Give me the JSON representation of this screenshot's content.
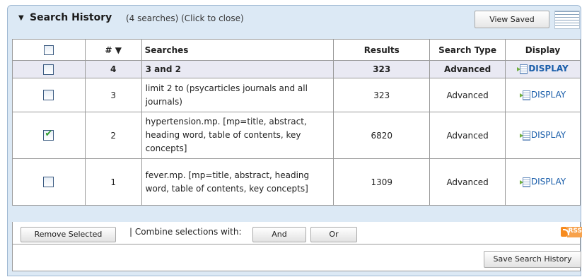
{
  "header": {
    "toggle_icon": "triangle-down-icon",
    "title": "Search History",
    "subtitle": "(4 searches) (Click to close)",
    "view_saved_label": "View Saved"
  },
  "table": {
    "columns": {
      "number": "# ▼",
      "searches": "Searches",
      "results": "Results",
      "search_type": "Search Type",
      "display": "Display"
    },
    "rows": [
      {
        "number": "4",
        "search": "3 and 2",
        "results": "323",
        "type": "Advanced",
        "display": "DISPLAY",
        "checked": false
      },
      {
        "number": "3",
        "search": "limit 2 to (psycarticles journals and all journals)",
        "results": "323",
        "type": "Advanced",
        "display": "DISPLAY",
        "checked": false
      },
      {
        "number": "2",
        "search": "hypertension.mp. [mp=title, abstract, heading word, table of contents, key concepts]",
        "results": "6820",
        "type": "Advanced",
        "display": "DISPLAY",
        "checked": true
      },
      {
        "number": "1",
        "search": "fever.mp. [mp=title, abstract, heading word, table of contents, key concepts]",
        "results": "1309",
        "type": "Advanced",
        "display": "DISPLAY",
        "checked": false
      }
    ]
  },
  "footer": {
    "remove_selected_label": "Remove Selected",
    "combine_text": "| Combine selections with:",
    "and_label": "And",
    "or_label": "Or",
    "rss_label": "RSS",
    "save_history_label": "Save Search History"
  },
  "colors": {
    "panel_bg": "#dce9f5",
    "link": "#1a5eaa",
    "highlight_row": "#e9e9f3",
    "rss": "#f78b1e"
  }
}
